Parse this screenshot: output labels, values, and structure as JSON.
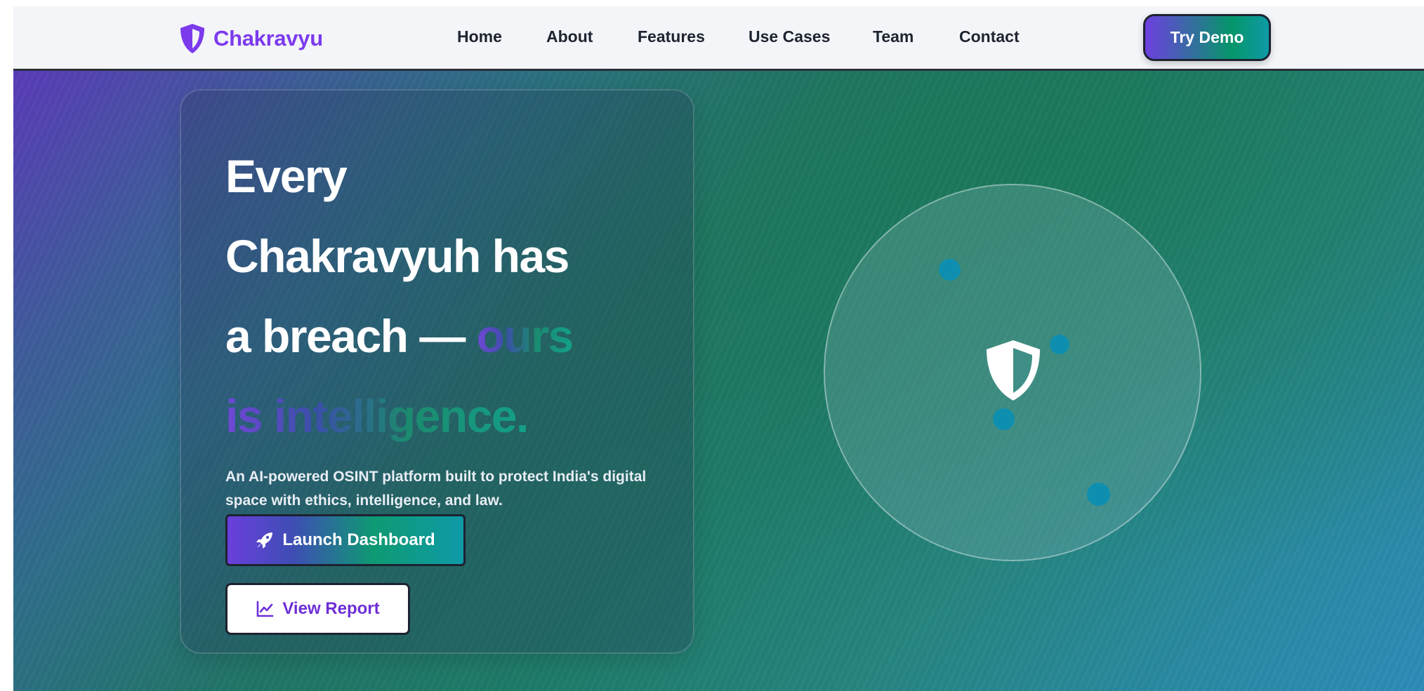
{
  "brand": {
    "name": "Chakravyu",
    "icon": "shield-icon",
    "color": "#7c3aed"
  },
  "nav": {
    "links": [
      {
        "label": "Home"
      },
      {
        "label": "About"
      },
      {
        "label": "Features"
      },
      {
        "label": "Use Cases"
      },
      {
        "label": "Team"
      },
      {
        "label": "Contact"
      }
    ],
    "cta_label": "Try Demo"
  },
  "hero": {
    "headline_line1": "Every",
    "headline_line2": "Chakravyuh has",
    "headline_line3": "a breach — ",
    "headline_accent1": "ours",
    "headline_accent2": "is intelligence.",
    "subtitle": "An AI-powered OSINT platform built to protect India's digital space with ethics, intelligence, and law.",
    "primary_button": {
      "label": "Launch Dashboard",
      "icon": "rocket-icon"
    },
    "secondary_button": {
      "label": "View Report",
      "icon": "chart-line-icon"
    }
  },
  "radar": {
    "icon": "shield-half-icon",
    "dot_color": "#0f8fb0"
  },
  "colors": {
    "accent_purple": "#7c3aed",
    "accent_green": "#059669",
    "accent_teal": "#0e9aa7"
  }
}
